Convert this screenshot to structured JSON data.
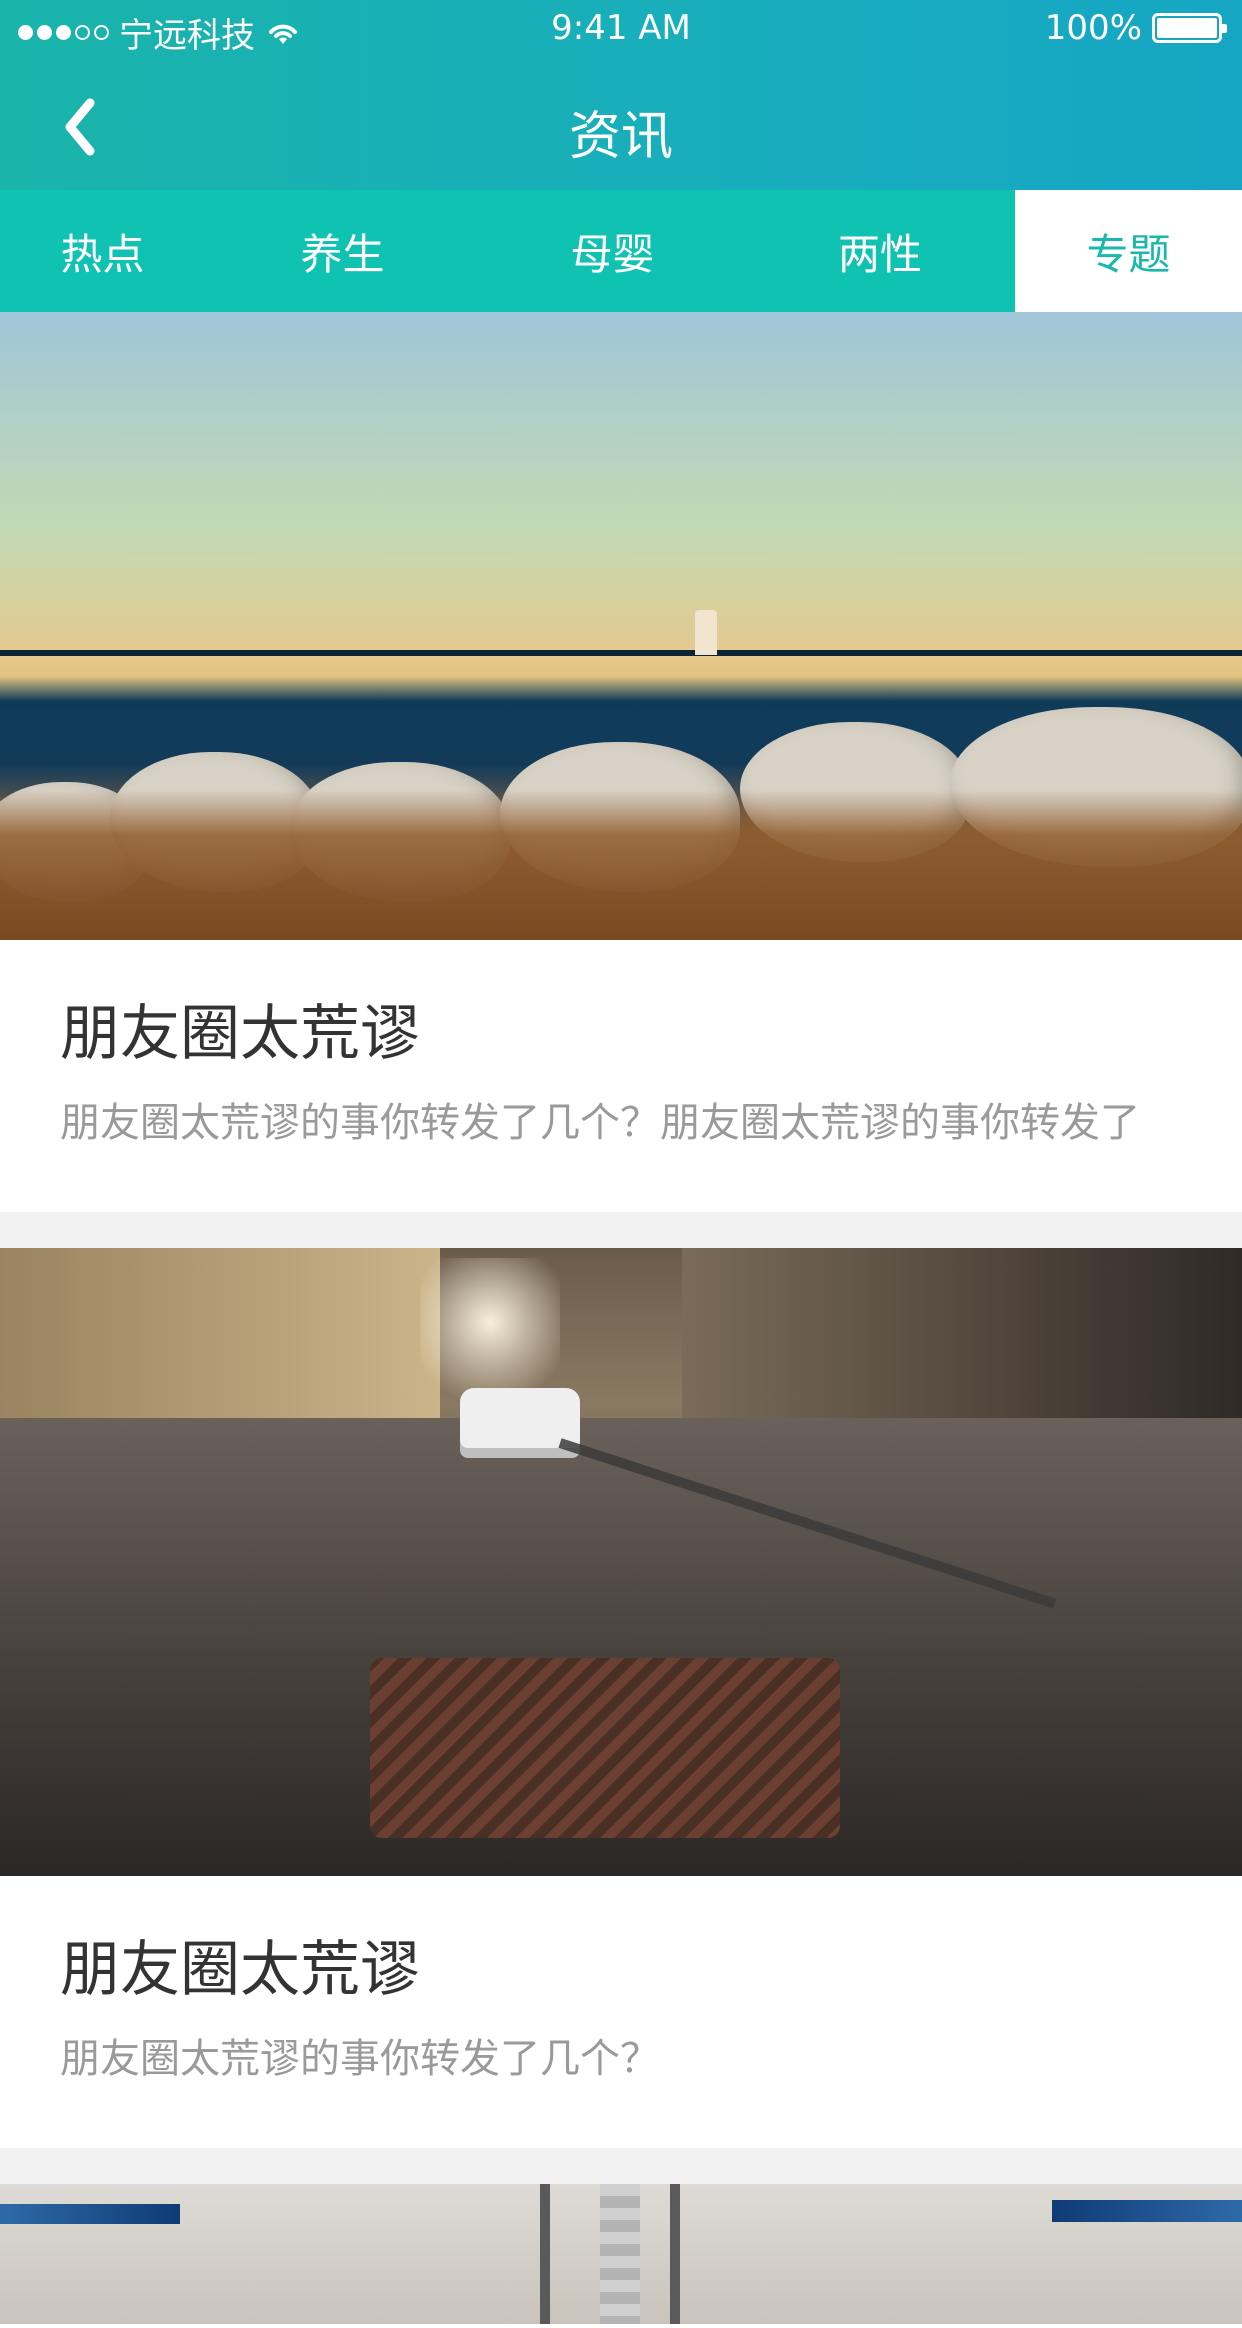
{
  "status_bar": {
    "carrier": "宁远科技",
    "time": "9:41 AM",
    "battery": "100%",
    "signal_dots_filled": 3,
    "signal_dots_total": 5
  },
  "nav": {
    "title": "资讯",
    "back_icon": "chevron-left-icon"
  },
  "tabs": [
    {
      "label": "热点",
      "active": false
    },
    {
      "label": "养生",
      "active": false
    },
    {
      "label": "母婴",
      "active": false
    },
    {
      "label": "两性",
      "active": false
    },
    {
      "label": "专题",
      "active": true
    }
  ],
  "cards": [
    {
      "title": "朋友圈太荒谬",
      "description": "朋友圈太荒谬的事你转发了几个？朋友圈太荒谬的事你转发了"
    },
    {
      "title": "朋友圈太荒谬",
      "description": "朋友圈太荒谬的事你转发了几个？"
    }
  ],
  "colors": {
    "header_gradient": [
      "#19b4aa",
      "#16a6c4"
    ],
    "tab_bar": "#10c2b2",
    "active_tab_text": "#19b8ad",
    "title_text": "#333333",
    "desc_text": "#9a9a9a",
    "page_bg": "#f2f2f2"
  }
}
